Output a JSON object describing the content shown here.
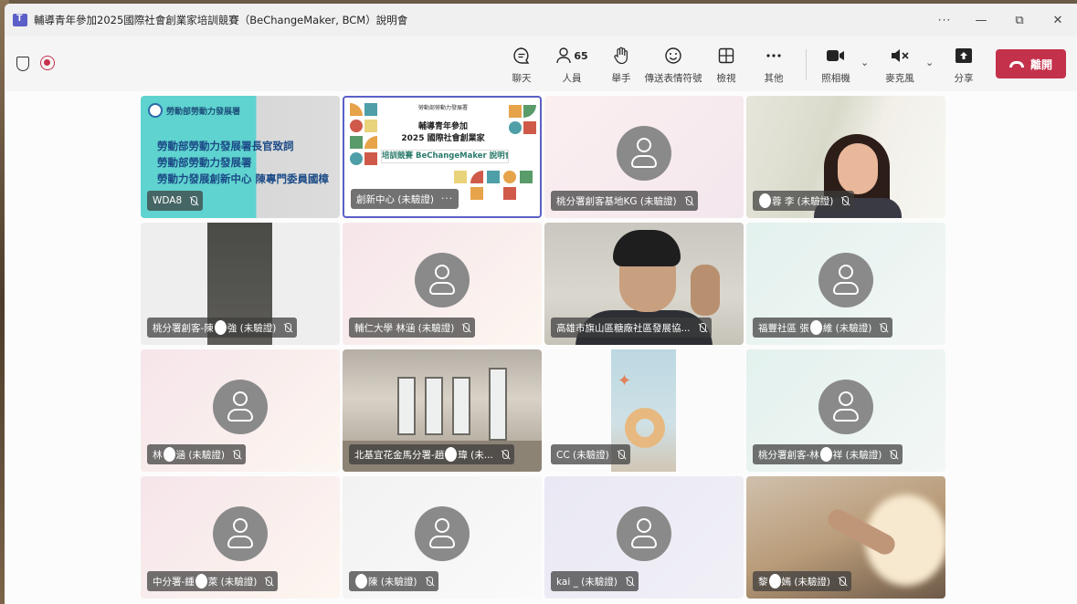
{
  "window": {
    "title": "輔導青年參加2025國際社會創業家培訓競賽（BeChangeMaker, BCM）說明會",
    "more": "···",
    "minimize": "—",
    "restore": "⧉",
    "close": "✕"
  },
  "toolbar": {
    "chat": "聊天",
    "people": "人員",
    "people_count": "65",
    "raise_hand": "舉手",
    "reactions": "傳送表情符號",
    "view": "檢視",
    "more": "其他",
    "camera": "照相機",
    "mic": "麥克風",
    "share": "分享",
    "leave": "離開",
    "icons": {
      "chat": "chat-icon",
      "people": "people-icon",
      "raise_hand": "hand-icon",
      "reactions": "smiley-icon",
      "view": "grid-icon",
      "more": "ellipsis-icon",
      "camera": "camera-icon",
      "mic": "mic-off-icon",
      "share": "share-icon"
    },
    "accent": "#c4314b"
  },
  "slides": {
    "teal": {
      "org": "勞動部勞動力發展署",
      "lines": [
        "勞動部勞動力發展署長官致詞",
        "勞動部勞動力發展署",
        "勞動力發展創新中心 陳專門委員國樟"
      ]
    },
    "colorful": {
      "org": "勞動部勞動力發展署",
      "line1": "輔導青年參加",
      "line2": "2025 國際社會創業家",
      "band": "培訓競賽 BeChangeMaker 說明會"
    }
  },
  "tiles": [
    {
      "a": "WDA8",
      "b": ""
    },
    {
      "a": "創新中心 (未驗證)",
      "b": "···"
    },
    {
      "a": "桃分署創客基地KG (未驗證)",
      "b": ""
    },
    {
      "a": "",
      "b": "蓉 李 (未驗證)"
    },
    {
      "a": "桃分署創客-陳",
      "b": "強 (未驗證)"
    },
    {
      "a": "輔仁大學 林",
      "b": "涵 (未驗證)"
    },
    {
      "a": "高雄市旗山區糖廠社區發展協...",
      "b": ""
    },
    {
      "a": "福豐社區 張",
      "b": "維 (未驗證)"
    },
    {
      "a": "林",
      "b": "涵 (未驗證)"
    },
    {
      "a": "北基宜花金馬分署-趙",
      "b": "瑋 (未..."
    },
    {
      "a": "CC (未驗證)",
      "b": ""
    },
    {
      "a": "桃分署創客-林",
      "b": "祥 (未驗證)"
    },
    {
      "a": "中分署-鍾",
      "b": "萊 (未驗證)"
    },
    {
      "a": "",
      "b": "陳 (未驗證)"
    },
    {
      "a": "kai _ (未驗證)",
      "b": ""
    },
    {
      "a": "黎",
      "b": "嫣 (未驗證)"
    }
  ]
}
